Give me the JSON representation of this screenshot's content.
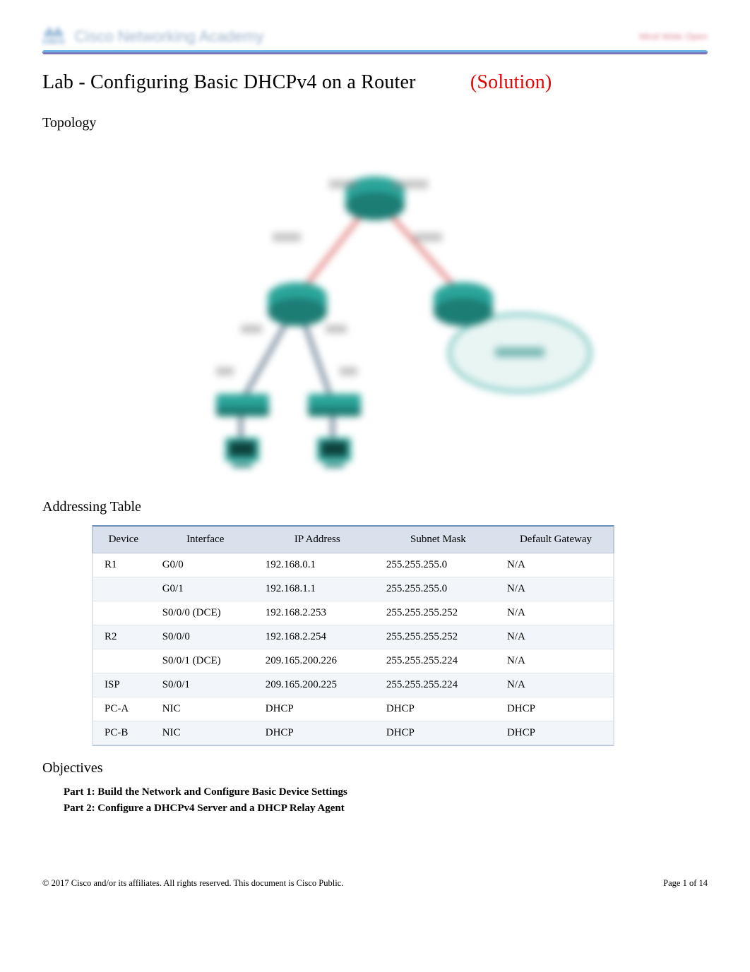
{
  "header": {
    "logo_text": "CISCO",
    "academy_text": "Cisco Networking Academy",
    "right_text": "Mind Wide Open"
  },
  "title": {
    "main": "Lab - Configuring Basic DHCPv4 on a Router",
    "solution": "(Solution)"
  },
  "sections": {
    "topology": "Topology",
    "addressing": "Addressing Table",
    "objectives": "Objectives"
  },
  "addressing_table": {
    "headers": [
      "Device",
      "Interface",
      "IP Address",
      "Subnet Mask",
      "Default Gateway"
    ],
    "rows": [
      {
        "device": "R1",
        "interface": "G0/0",
        "ip": "192.168.0.1",
        "mask": "255.255.255.0",
        "gw": "N/A"
      },
      {
        "device": "",
        "interface": "G0/1",
        "ip": "192.168.1.1",
        "mask": "255.255.255.0",
        "gw": "N/A"
      },
      {
        "device": "",
        "interface": "S0/0/0 (DCE)",
        "ip": "192.168.2.253",
        "mask": "255.255.255.252",
        "gw": "N/A"
      },
      {
        "device": "R2",
        "interface": "S0/0/0",
        "ip": "192.168.2.254",
        "mask": "255.255.255.252",
        "gw": "N/A"
      },
      {
        "device": "",
        "interface": "S0/0/1 (DCE)",
        "ip": "209.165.200.226",
        "mask": "255.255.255.224",
        "gw": "N/A"
      },
      {
        "device": "ISP",
        "interface": "S0/0/1",
        "ip": "209.165.200.225",
        "mask": "255.255.255.224",
        "gw": "N/A"
      },
      {
        "device": "PC-A",
        "interface": "NIC",
        "ip": "DHCP",
        "mask": "DHCP",
        "gw": "DHCP"
      },
      {
        "device": "PC-B",
        "interface": "NIC",
        "ip": "DHCP",
        "mask": "DHCP",
        "gw": "DHCP"
      }
    ]
  },
  "objectives": {
    "part1": "Part 1: Build the Network and Configure Basic Device Settings",
    "part2": "Part 2: Configure a DHCPv4 Server and a DHCP Relay Agent"
  },
  "footer": {
    "copyright": "© 2017 Cisco and/or its affiliates. All rights reserved. This document is Cisco Public.",
    "page": "Page   1 of 14"
  },
  "colors": {
    "accent_blue": "#1a5fa3",
    "solution_red": "#e60000",
    "table_header_bg": "#d9e1ec",
    "teal": "#2aa59a"
  }
}
